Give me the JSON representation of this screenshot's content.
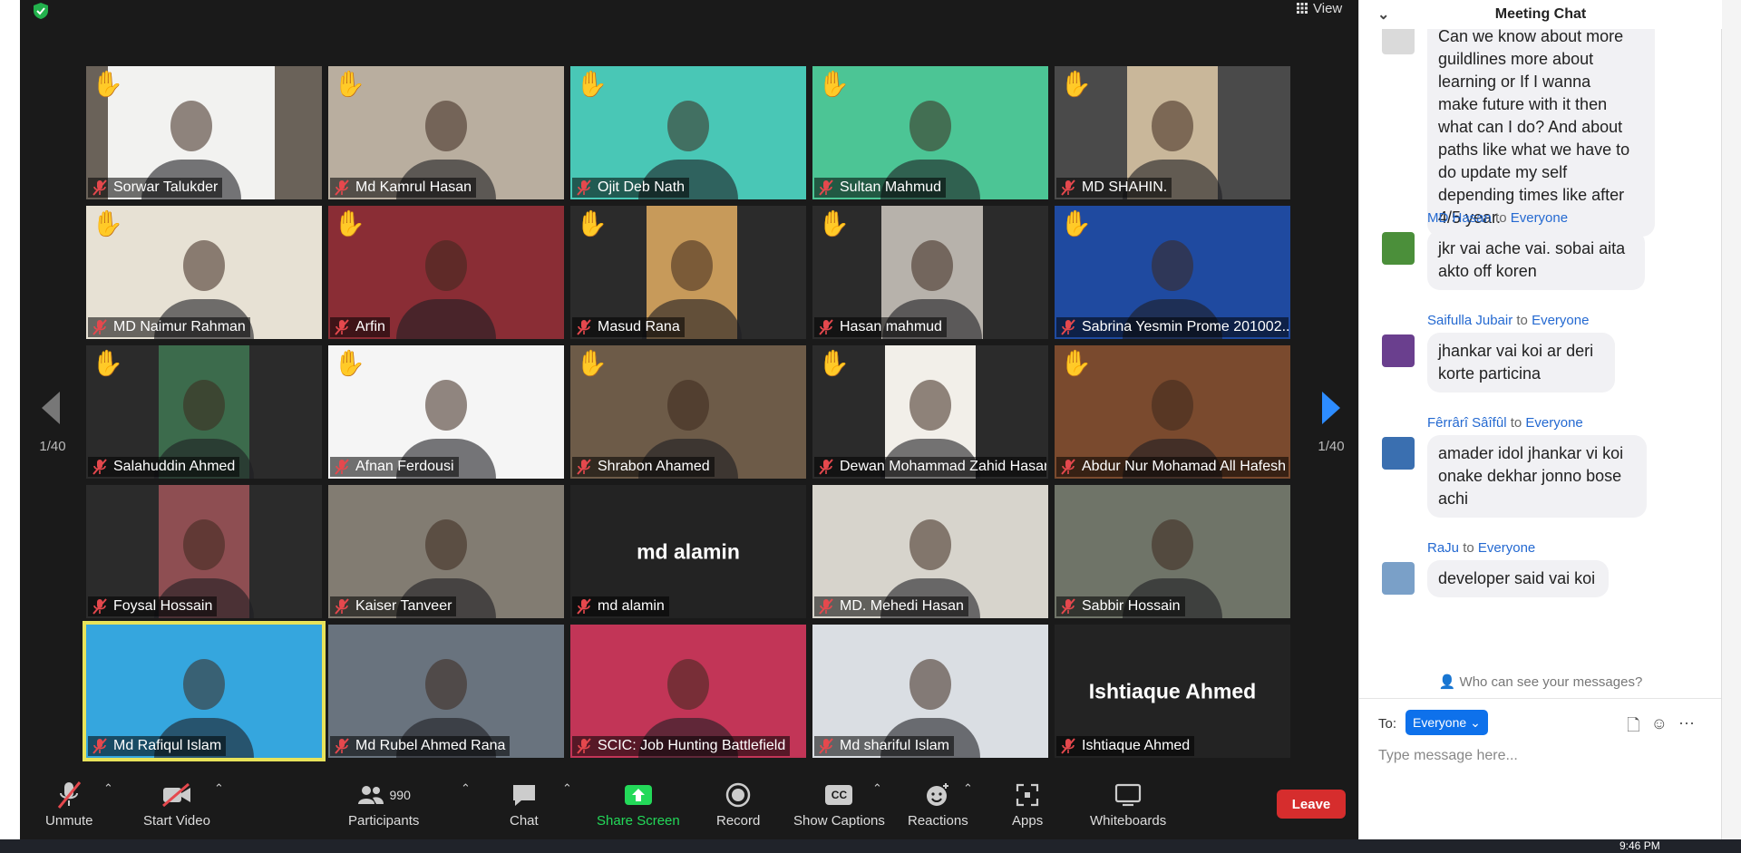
{
  "toolbar": {
    "unmute": "Unmute",
    "start_video": "Start Video",
    "participants": "Participants",
    "participant_count": "990",
    "chat": "Chat",
    "share_screen": "Share Screen",
    "record": "Record",
    "show_captions": "Show Captions",
    "reactions": "Reactions",
    "apps": "Apps",
    "whiteboards": "Whiteboards",
    "leave": "Leave",
    "cc_glyph": "CC"
  },
  "view_label": "View",
  "page_indicator": "1/40",
  "tiles": [
    {
      "name": "Sorwar Talukder",
      "hand": true
    },
    {
      "name": "Md Kamrul Hasan",
      "hand": true
    },
    {
      "name": "Ojit Deb Nath",
      "hand": true
    },
    {
      "name": "Sultan Mahmud",
      "hand": true
    },
    {
      "name": "MD SHAHIN.",
      "hand": true
    },
    {
      "name": "MD Naimur Rahman",
      "hand": true
    },
    {
      "name": "Arfin",
      "hand": true
    },
    {
      "name": "Masud Rana",
      "hand": true
    },
    {
      "name": "Hasan mahmud",
      "hand": true
    },
    {
      "name": "Sabrina Yesmin Prome 201002...",
      "hand": true
    },
    {
      "name": "Salahuddin Ahmed",
      "hand": true
    },
    {
      "name": "Afnan Ferdousi",
      "hand": true
    },
    {
      "name": "Shrabon Ahamed",
      "hand": true
    },
    {
      "name": "Dewan Mohammad Zahid Hasan",
      "hand": true
    },
    {
      "name": "Abdur Nur Mohamad All Hafesh",
      "hand": true
    },
    {
      "name": "Foysal Hossain",
      "hand": false
    },
    {
      "name": "Kaiser Tanveer",
      "hand": false
    },
    {
      "name": "md alamin",
      "hand": false,
      "display": "md alamin"
    },
    {
      "name": "MD. Mehedi Hasan",
      "hand": false
    },
    {
      "name": "Sabbir Hossain",
      "hand": false
    },
    {
      "name": "Md Rafiqul Islam",
      "hand": false
    },
    {
      "name": "Md Rubel Ahmed Rana",
      "hand": false
    },
    {
      "name": "SCIC: Job Hunting Battlefield",
      "hand": false
    },
    {
      "name": "Md shariful Islam",
      "hand": false
    },
    {
      "name": "Ishtiaque Ahmed",
      "hand": false,
      "display": "Ishtiaque Ahmed"
    }
  ],
  "chat": {
    "title": "Meeting Chat",
    "first_message_lines": [
      "Can we know about more",
      "guildlines more about",
      "learning or If I wanna",
      "make future with it then",
      "what can I do? And about",
      "paths like what we have to",
      "do update my self",
      "depending times like after",
      "4/5 year."
    ],
    "messages": [
      {
        "sender": "MD Hasan",
        "to": "to",
        "recipient": "Everyone",
        "lines": [
          "jkr vai ache vai. sobai aita",
          "akto off koren"
        ]
      },
      {
        "sender": "Saifulla Jubair",
        "to": "to",
        "recipient": "Everyone",
        "lines": [
          "jhankar vai koi ar deri",
          "korte particina"
        ]
      },
      {
        "sender": "Fêrrârî Sâîfûl",
        "to": "to",
        "recipient": "Everyone",
        "lines": [
          "amader idol jhankar vi koi",
          "onake dekhar jonno bose",
          "achi"
        ]
      },
      {
        "sender": "RaJu",
        "to": "to",
        "recipient": "Everyone",
        "lines": [
          "developer said vai koi"
        ]
      }
    ],
    "who_can_see": "Who can see your messages?",
    "to_label": "To:",
    "recipient": "Everyone",
    "input_placeholder": "Type message here..."
  },
  "taskbar": {
    "clock": "9:46 PM"
  }
}
